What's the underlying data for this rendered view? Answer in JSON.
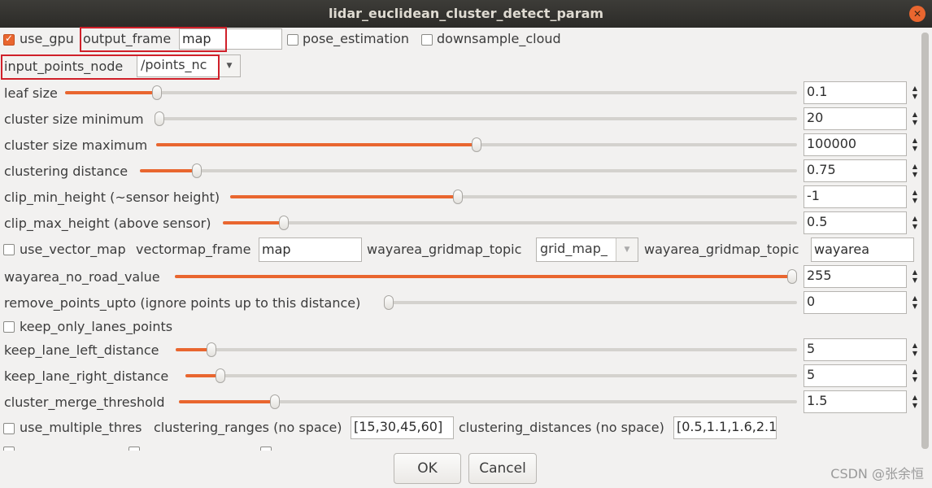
{
  "window": {
    "title": "lidar_euclidean_cluster_detect_param",
    "close_glyph": "✕"
  },
  "row1": {
    "use_gpu_label": "use_gpu",
    "use_gpu_checked": true,
    "output_frame_label": "output_frame",
    "output_frame_value": "map",
    "pose_estimation_label": "pose_estimation",
    "downsample_cloud_label": "downsample_cloud"
  },
  "row2": {
    "input_points_node_label": "input_points_node",
    "input_points_node_value": "/points_nc",
    "arrow": "▼"
  },
  "sliders": [
    {
      "label": "leaf size",
      "value": "0.1",
      "level": 0.12
    },
    {
      "label": "cluster size minimum",
      "value": "20",
      "level": 0.0
    },
    {
      "label": "cluster size maximum",
      "value": "100000",
      "level": 0.5
    },
    {
      "label": "clustering distance",
      "value": "0.75",
      "level": 0.08
    },
    {
      "label": "clip_min_height (~sensor height)",
      "value": "-1",
      "level": 0.4
    },
    {
      "label": "clip_max_height (above sensor)",
      "value": "0.5",
      "level": 0.1
    }
  ],
  "vector_row": {
    "use_vector_map_label": "use_vector_map",
    "vectormap_frame_label": "vectormap_frame",
    "vectormap_frame_value": "map",
    "gridmap_topic_label": "wayarea_gridmap_topic",
    "gridmap_topic_value": "grid_map_",
    "gridmap_topic2_label": "wayarea_gridmap_topic",
    "gridmap_topic2_value": "wayarea",
    "arrow": "▼"
  },
  "sliders2": [
    {
      "label": "wayarea_no_road_value",
      "value": "255",
      "level": 1.0
    },
    {
      "label": "remove_points_upto (ignore points up to this distance)",
      "value": "0",
      "level": 0.0
    }
  ],
  "keep_only_lanes_label": "keep_only_lanes_points",
  "sliders3": [
    {
      "label": "keep_lane_left_distance",
      "value": "5",
      "level": 0.05
    },
    {
      "label": "keep_lane_right_distance",
      "value": "5",
      "level": 0.05
    },
    {
      "label": "cluster_merge_threshold",
      "value": "1.5",
      "level": 0.15
    }
  ],
  "multi_row": {
    "use_multiple_thres_label": "use_multiple_thres",
    "clustering_ranges_label": "clustering_ranges (no space)",
    "clustering_ranges_value": "[15,30,45,60]",
    "clustering_distances_label": "clustering_distances (no space)",
    "clustering_distances_value": "[0.5,1.1,1.6,2.1"
  },
  "buttons": {
    "ok": "OK",
    "cancel": "Cancel"
  },
  "watermark": "CSDN @张余恒",
  "colors": {
    "accent": "#e9662f",
    "highlight": "#d0202a",
    "titlebar": "#2c2b28"
  }
}
